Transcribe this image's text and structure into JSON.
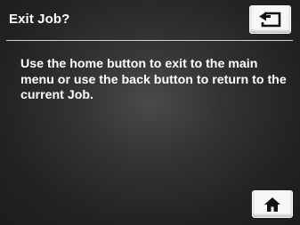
{
  "header": {
    "title": "Exit Job?"
  },
  "message": {
    "text": "Use the home button to exit to the main menu or use the back button to return to the current Job."
  },
  "buttons": {
    "back_icon": "back-arrow-icon",
    "home_icon": "home-icon"
  },
  "colors": {
    "background_center": "#4a4a4a",
    "background_edge": "#1c1c1c",
    "button_face": "#f7f7f7",
    "icon": "#111111",
    "text": "#ffffff"
  }
}
